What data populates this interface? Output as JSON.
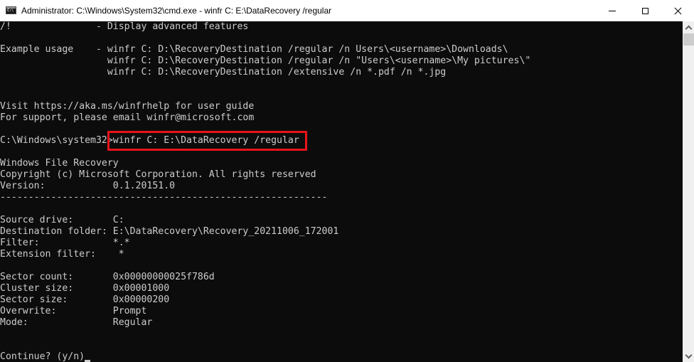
{
  "window": {
    "title": "Administrator: C:\\Windows\\System32\\cmd.exe - winfr  C: E:\\DataRecovery /regular",
    "app_icon": "cmd-console-icon",
    "buttons": {
      "minimize": "minimize-icon",
      "maximize": "maximize-icon",
      "close": "close-icon"
    }
  },
  "console": {
    "colors": {
      "background": "#0c0c0c",
      "foreground": "#cccccc",
      "highlight_box": "#e8131b"
    },
    "lines": [
      "/!               - Display advanced features",
      "",
      "Example usage    - winfr C: D:\\RecoveryDestination /regular /n Users\\<username>\\Downloads\\",
      "                   winfr C: D:\\RecoveryDestination /regular /n \"Users\\<username>\\My pictures\\\"",
      "                   winfr C: D:\\RecoveryDestination /extensive /n *.pdf /n *.jpg",
      "",
      "",
      "Visit https://aka.ms/winfrhelp for user guide",
      "For support, please email winfr@microsoft.com",
      "",
      "",
      "",
      "Windows File Recovery",
      "Copyright (c) Microsoft Corporation. All rights reserved",
      "Version:            0.1.20151.0",
      "----------------------------------------------------------",
      "",
      "Source drive:       C:",
      "Destination folder: E:\\DataRecovery\\Recovery_20211006_172001",
      "Filter:             *.*",
      "Extension filter:    *",
      "",
      "Sector count:       0x00000000025f786d",
      "Cluster size:       0x00001000",
      "Sector size:        0x00000200",
      "Overwrite:          Prompt",
      "Mode:               Regular",
      "",
      "",
      ""
    ],
    "prompt": {
      "path": "C:\\Windows\\system32",
      "command": ">winfr C: E:\\DataRecovery /regular"
    },
    "continue_prompt": "Continue? (y/n)"
  },
  "scrollbar": {
    "up_icon": "chevron-up-icon",
    "down_icon": "chevron-down-icon",
    "position_fraction": 0.0
  }
}
